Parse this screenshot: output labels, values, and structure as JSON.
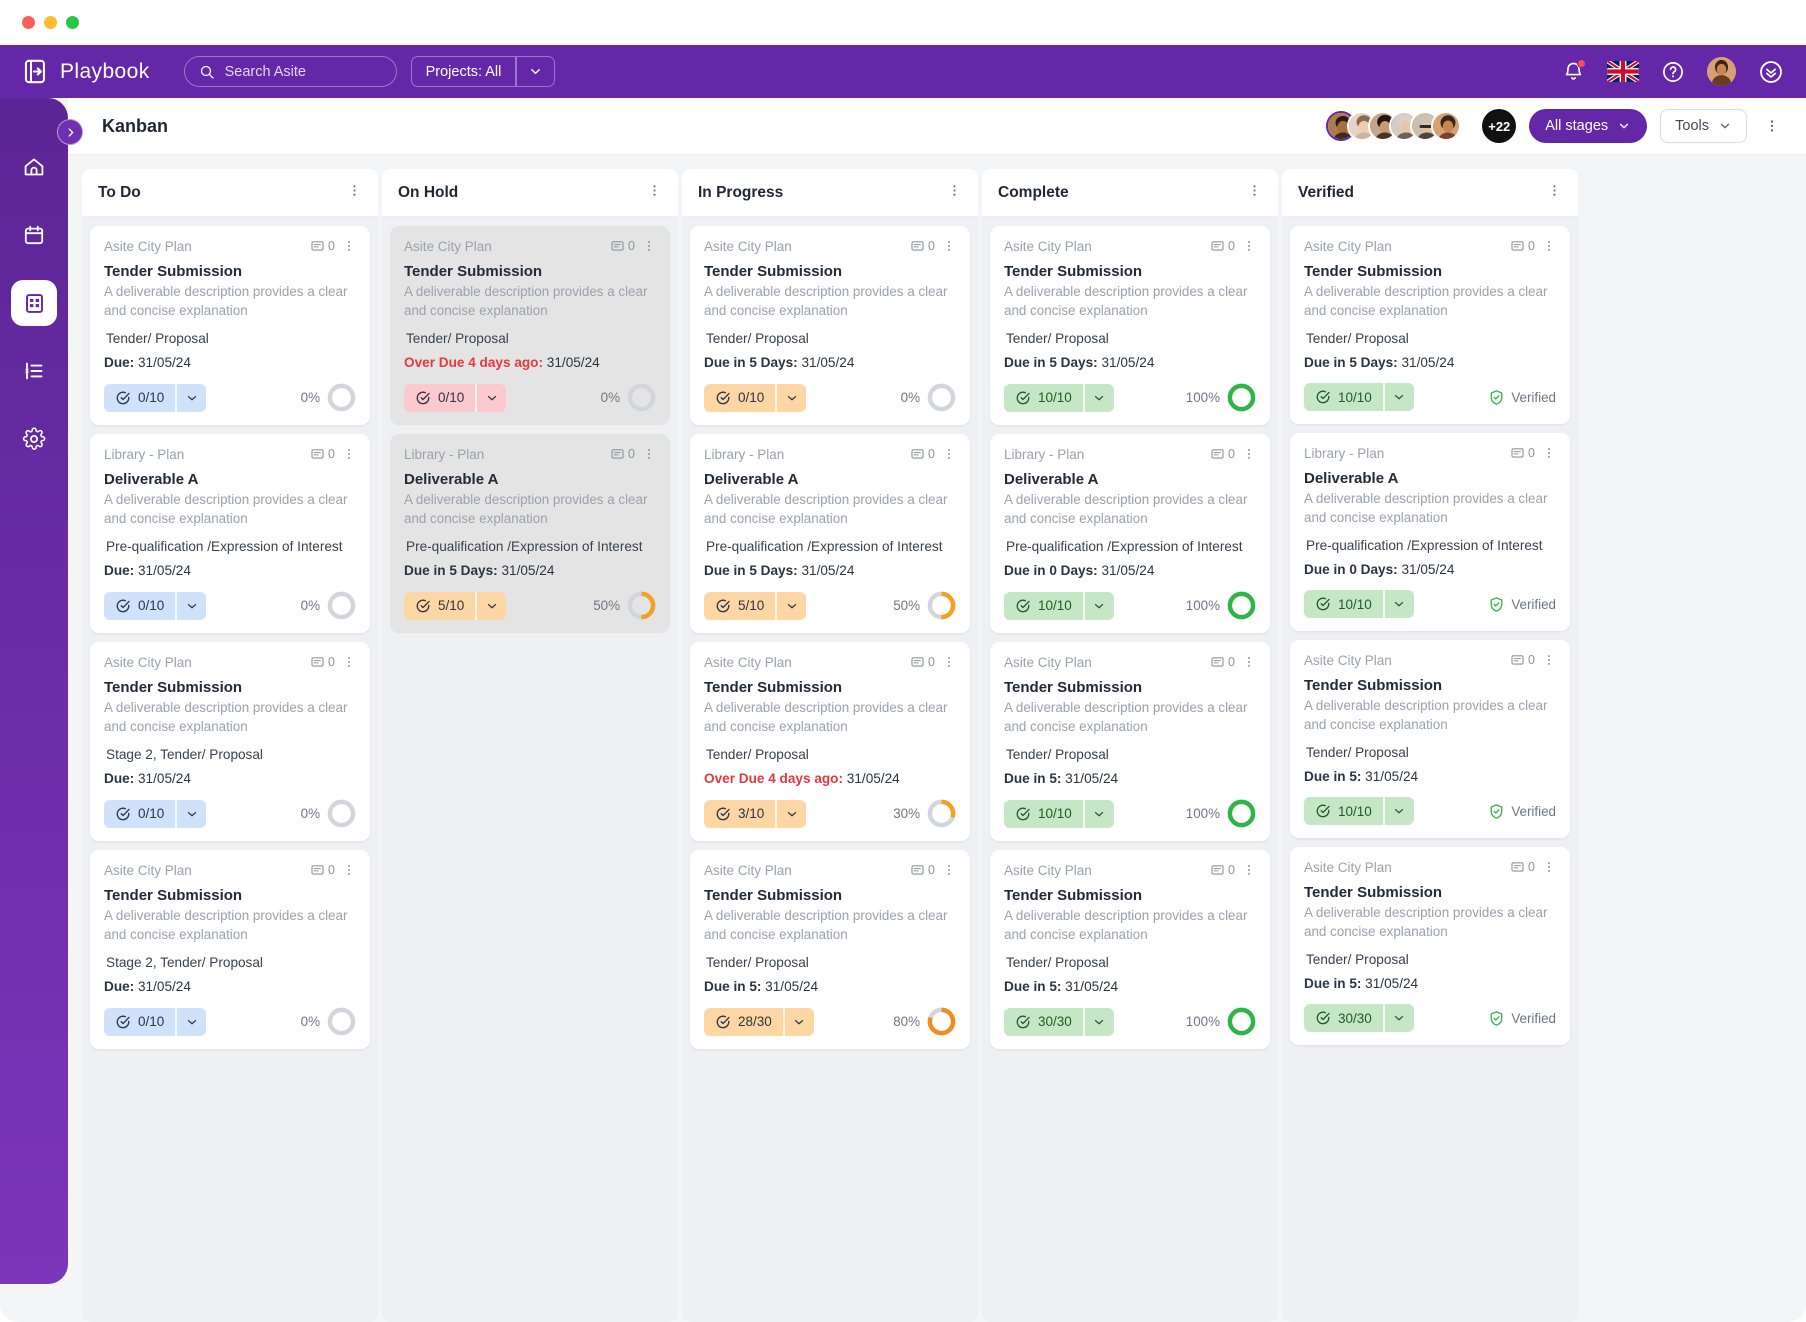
{
  "window": {
    "dots": [
      "close",
      "minimize",
      "zoom"
    ]
  },
  "topnav": {
    "brand": "Playbook",
    "search_placeholder": "Search Asite",
    "projects_label": "Projects: All",
    "icons": [
      "bell-icon",
      "uk-flag-icon",
      "help-icon",
      "user-avatar",
      "chevron-down-circle-icon"
    ]
  },
  "header": {
    "title": "Kanban",
    "avatar_overflow": "+22",
    "stages_label": "All stages",
    "tools_label": "Tools"
  },
  "sidebar": {
    "items": [
      {
        "name": "home-icon",
        "active": false
      },
      {
        "name": "calendar-icon",
        "active": false
      },
      {
        "name": "kanban-icon",
        "active": true
      },
      {
        "name": "list-icon",
        "active": false
      },
      {
        "name": "settings-icon",
        "active": false
      }
    ]
  },
  "board": {
    "columns": [
      {
        "title": "To Do",
        "cards": [
          {
            "project": "Asite City Plan",
            "comments": "0",
            "title": "Tender Submission",
            "desc": "A deliverable description provides a clear and concise explanation",
            "stage": "Tender/ Proposal",
            "due_prefix": "Due:",
            "due_date": "31/05/24",
            "overdue": false,
            "chip": "0/10",
            "chip_color": "blue",
            "pct": "0%",
            "pct_value": 0,
            "ring_color": "#cfd4da",
            "verified": false,
            "dim": false
          },
          {
            "project": "Library - Plan",
            "comments": "0",
            "title": "Deliverable A",
            "desc": "A deliverable description provides a clear and concise explanation",
            "stage": "Pre-qualification /Expression of Interest",
            "due_prefix": "Due:",
            "due_date": "31/05/24",
            "overdue": false,
            "chip": "0/10",
            "chip_color": "blue",
            "pct": "0%",
            "pct_value": 0,
            "ring_color": "#cfd4da",
            "verified": false,
            "dim": false
          },
          {
            "project": "Asite City Plan",
            "comments": "0",
            "title": "Tender Submission",
            "desc": "A deliverable description provides a clear and concise explanation",
            "stage": "Stage 2, Tender/ Proposal",
            "due_prefix": "Due:",
            "due_date": "31/05/24",
            "overdue": false,
            "chip": "0/10",
            "chip_color": "blue",
            "pct": "0%",
            "pct_value": 0,
            "ring_color": "#cfd4da",
            "verified": false,
            "dim": false
          },
          {
            "project": "Asite City Plan",
            "comments": "0",
            "title": "Tender Submission",
            "desc": "A deliverable description provides a clear and concise explanation",
            "stage": "Stage 2, Tender/ Proposal",
            "due_prefix": "Due:",
            "due_date": "31/05/24",
            "overdue": false,
            "chip": "0/10",
            "chip_color": "blue",
            "pct": "0%",
            "pct_value": 0,
            "ring_color": "#cfd4da",
            "verified": false,
            "dim": false
          }
        ]
      },
      {
        "title": "On Hold",
        "cards": [
          {
            "project": "Asite City Plan",
            "comments": "0",
            "title": "Tender Submission",
            "desc": "A deliverable description provides a clear and concise explanation",
            "stage": "Tender/ Proposal",
            "due_prefix": "Over Due 4 days ago:",
            "due_date": "31/05/24",
            "overdue": true,
            "chip": "0/10",
            "chip_color": "pink",
            "pct": "0%",
            "pct_value": 0,
            "ring_color": "#cfd4da",
            "verified": false,
            "dim": true
          },
          {
            "project": "Library - Plan",
            "comments": "0",
            "title": "Deliverable A",
            "desc": "A deliverable description provides a clear and concise explanation",
            "stage": "Pre-qualification /Expression of Interest",
            "due_prefix": "Due in 5 Days:",
            "due_date": "31/05/24",
            "overdue": false,
            "chip": "5/10",
            "chip_color": "amber",
            "pct": "50%",
            "pct_value": 50,
            "ring_color": "#f5a020",
            "verified": false,
            "dim": true
          }
        ]
      },
      {
        "title": "In Progress",
        "cards": [
          {
            "project": "Asite City Plan",
            "comments": "0",
            "title": "Tender Submission",
            "desc": "A deliverable description provides a clear and concise explanation",
            "stage": "Tender/ Proposal",
            "due_prefix": "Due in 5 Days:",
            "due_date": "31/05/24",
            "overdue": false,
            "chip": "0/10",
            "chip_color": "amber",
            "pct": "0%",
            "pct_value": 0,
            "ring_color": "#cfd4da",
            "verified": false,
            "dim": false
          },
          {
            "project": "Library - Plan",
            "comments": "0",
            "title": "Deliverable A",
            "desc": "A deliverable description provides a clear and concise explanation",
            "stage": "Pre-qualification /Expression of Interest",
            "due_prefix": "Due in 5 Days:",
            "due_date": "31/05/24",
            "overdue": false,
            "chip": "5/10",
            "chip_color": "amber",
            "pct": "50%",
            "pct_value": 50,
            "ring_color": "#f5a020",
            "verified": false,
            "dim": false
          },
          {
            "project": "Asite City Plan",
            "comments": "0",
            "title": "Tender Submission",
            "desc": "A deliverable description provides a clear and concise explanation",
            "stage": "Tender/ Proposal",
            "due_prefix": "Over Due 4 days ago:",
            "due_date": "31/05/24",
            "overdue": true,
            "chip": "3/10",
            "chip_color": "amber",
            "pct": "30%",
            "pct_value": 30,
            "ring_color": "#f5a020",
            "verified": false,
            "dim": false
          },
          {
            "project": "Asite City Plan",
            "comments": "0",
            "title": "Tender Submission",
            "desc": "A deliverable description provides a clear and concise explanation",
            "stage": "Tender/ Proposal",
            "due_prefix": "Due in 5:",
            "due_date": "31/05/24",
            "overdue": false,
            "chip": "28/30",
            "chip_color": "amber",
            "pct": "80%",
            "pct_value": 80,
            "ring_color": "#f58a1f",
            "verified": false,
            "dim": false
          }
        ]
      },
      {
        "title": "Complete",
        "cards": [
          {
            "project": "Asite City Plan",
            "comments": "0",
            "title": "Tender Submission",
            "desc": "A deliverable description provides a clear and concise explanation",
            "stage": "Tender/ Proposal",
            "due_prefix": "Due in 5 Days:",
            "due_date": "31/05/24",
            "overdue": false,
            "chip": "10/10",
            "chip_color": "green",
            "pct": "100%",
            "pct_value": 100,
            "ring_color": "#2fb44a",
            "verified": false,
            "dim": false
          },
          {
            "project": "Library - Plan",
            "comments": "0",
            "title": "Deliverable A",
            "desc": "A deliverable description provides a clear and concise explanation",
            "stage": "Pre-qualification /Expression of Interest",
            "due_prefix": "Due in 0 Days:",
            "due_date": "31/05/24",
            "overdue": false,
            "chip": "10/10",
            "chip_color": "green",
            "pct": "100%",
            "pct_value": 100,
            "ring_color": "#2fb44a",
            "verified": false,
            "dim": false
          },
          {
            "project": "Asite City Plan",
            "comments": "0",
            "title": "Tender Submission",
            "desc": "A deliverable description provides a clear and concise explanation",
            "stage": "Tender/ Proposal",
            "due_prefix": "Due in 5:",
            "due_date": "31/05/24",
            "overdue": false,
            "chip": "10/10",
            "chip_color": "green",
            "pct": "100%",
            "pct_value": 100,
            "ring_color": "#2fb44a",
            "verified": false,
            "dim": false
          },
          {
            "project": "Asite City Plan",
            "comments": "0",
            "title": "Tender Submission",
            "desc": "A deliverable description provides a clear and concise explanation",
            "stage": "Tender/ Proposal",
            "due_prefix": "Due in 5:",
            "due_date": "31/05/24",
            "overdue": false,
            "chip": "30/30",
            "chip_color": "green",
            "pct": "100%",
            "pct_value": 100,
            "ring_color": "#2fb44a",
            "verified": false,
            "dim": false
          }
        ]
      },
      {
        "title": "Verified",
        "cards": [
          {
            "project": "Asite City Plan",
            "comments": "0",
            "title": "Tender Submission",
            "desc": "A deliverable description provides a clear and concise explanation",
            "stage": "Tender/ Proposal",
            "due_prefix": "Due in 5 Days:",
            "due_date": "31/05/24",
            "overdue": false,
            "chip": "10/10",
            "chip_color": "green",
            "verified": true,
            "verified_label": "Verified",
            "dim": false
          },
          {
            "project": "Library - Plan",
            "comments": "0",
            "title": "Deliverable A",
            "desc": "A deliverable description provides a clear and concise explanation",
            "stage": "Pre-qualification /Expression of Interest",
            "due_prefix": "Due in 0 Days:",
            "due_date": "31/05/24",
            "overdue": false,
            "chip": "10/10",
            "chip_color": "green",
            "verified": true,
            "verified_label": "Verified",
            "dim": false
          },
          {
            "project": "Asite City Plan",
            "comments": "0",
            "title": "Tender Submission",
            "desc": "A deliverable description provides a clear and concise explanation",
            "stage": "Tender/ Proposal",
            "due_prefix": "Due in 5:",
            "due_date": "31/05/24",
            "overdue": false,
            "chip": "10/10",
            "chip_color": "green",
            "verified": true,
            "verified_label": "Verified",
            "dim": false
          },
          {
            "project": "Asite City Plan",
            "comments": "0",
            "title": "Tender Submission",
            "desc": "A deliverable description provides a clear and concise explanation",
            "stage": "Tender/ Proposal",
            "due_prefix": "Due in 5:",
            "due_date": "31/05/24",
            "overdue": false,
            "chip": "30/30",
            "chip_color": "green",
            "verified": true,
            "verified_label": "Verified",
            "dim": false
          }
        ]
      }
    ]
  },
  "colors": {
    "brand_purple": "#6327a8",
    "overdue_red": "#e8373d",
    "green": "#2fb44a",
    "amber": "#f5a020"
  }
}
